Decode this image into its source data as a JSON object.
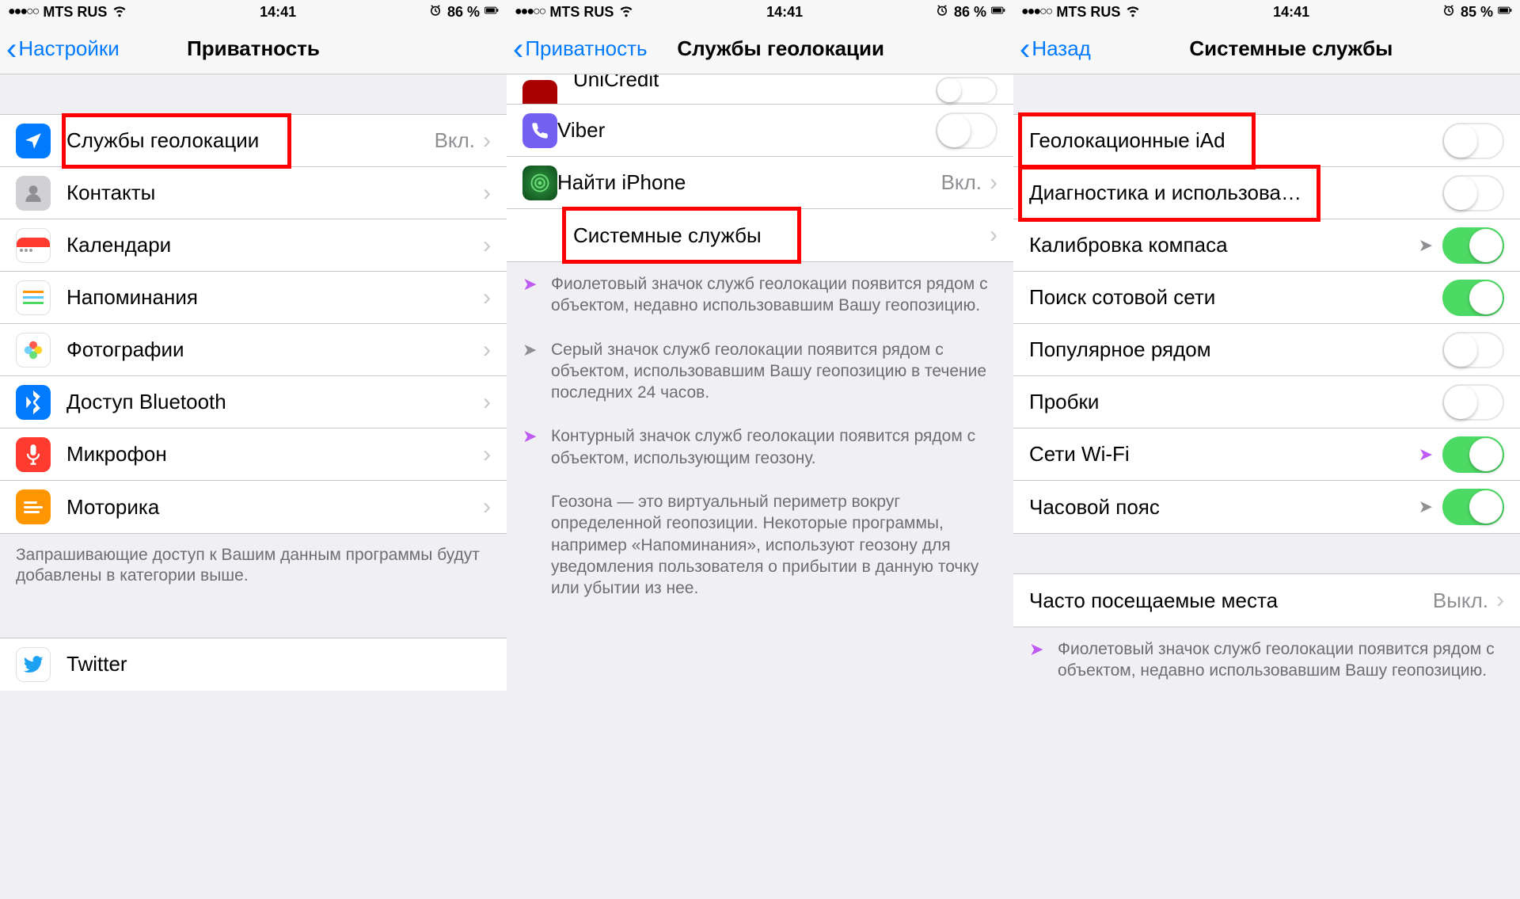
{
  "status": {
    "carrier": "MTS RUS",
    "time": "14:41",
    "battery1": "86 %",
    "battery2": "86 %",
    "battery3": "85 %",
    "signal_dots": "●●●○○"
  },
  "screen1": {
    "back": "Настройки",
    "title": "Приватность",
    "rows": [
      {
        "label": "Службы геолокации",
        "value": "Вкл.",
        "icon_bg": "#007aff",
        "glyph": "➤",
        "name": "location-services"
      },
      {
        "label": "Контакты",
        "icon_bg": "#d9d9de",
        "glyph": "👤",
        "name": "contacts"
      },
      {
        "label": "Календари",
        "icon_bg": "#ffffff",
        "glyph": "📅",
        "name": "calendars"
      },
      {
        "label": "Напоминания",
        "icon_bg": "#ffffff",
        "glyph": "☰",
        "name": "reminders"
      },
      {
        "label": "Фотографии",
        "icon_bg": "#ffffff",
        "glyph": "✿",
        "name": "photos"
      },
      {
        "label": "Доступ Bluetooth",
        "icon_bg": "#007aff",
        "glyph": "B",
        "name": "bluetooth-access"
      },
      {
        "label": "Микрофон",
        "icon_bg": "#ff3b30",
        "glyph": "🎤",
        "name": "microphone"
      },
      {
        "label": "Моторика",
        "icon_bg": "#ff9500",
        "glyph": "≡",
        "name": "motorics"
      }
    ],
    "footer": "Запрашивающие доступ к Вашим данным программы будут добавлены в категории выше.",
    "bottom_row": {
      "label": "Twitter",
      "icon_bg": "#ffffff",
      "glyph": "🐦",
      "name": "twitter"
    }
  },
  "screen2": {
    "back": "Приватность",
    "title": "Службы геолокации",
    "partial_top": "UniCredit",
    "rows": [
      {
        "label": "Viber",
        "icon_bg": "#7360f2",
        "glyph": "V",
        "toggle": "off",
        "name": "viber"
      },
      {
        "label": "Найти iPhone",
        "icon_bg": "#1a6b2d",
        "glyph": "◉",
        "value": "Вкл.",
        "chevron": true,
        "name": "find-iphone"
      },
      {
        "label": "Системные службы",
        "chevron": true,
        "no_icon": true,
        "name": "system-services"
      }
    ],
    "notes": [
      {
        "arrow": "purple",
        "text": "Фиолетовый значок служб геолокации появится рядом с объектом, недавно использовавшим Вашу геопозицию."
      },
      {
        "arrow": "gray",
        "text": "Серый значок служб геолокации появится рядом с объектом, использовавшим Вашу геопозицию в течение последних 24 часов."
      },
      {
        "arrow": "outline",
        "text": "Контурный значок служб геолокации появится рядом с объектом, использующим геозону."
      }
    ],
    "geofence_text": "Геозона — это виртуальный периметр вокруг определенной геопозиции. Некоторые программы, например «Напоминания», используют геозону для уведомления пользователя о прибытии в данную точку или убытии из нее."
  },
  "screen3": {
    "back": "Назад",
    "title": "Системные службы",
    "rows": [
      {
        "label": "Геолокационные iAd",
        "toggle": "off",
        "name": "location-iad"
      },
      {
        "label": "Диагностика и использова…",
        "toggle": "off",
        "name": "diagnostics-usage"
      },
      {
        "label": "Калибровка компаса",
        "toggle": "on",
        "indicator": "gray",
        "name": "compass-calibration"
      },
      {
        "label": "Поиск сотовой сети",
        "toggle": "on",
        "name": "cell-network-search"
      },
      {
        "label": "Популярное рядом",
        "toggle": "off",
        "name": "popular-nearby"
      },
      {
        "label": "Пробки",
        "toggle": "off",
        "name": "traffic"
      },
      {
        "label": "Сети Wi-Fi",
        "toggle": "on",
        "indicator": "purple",
        "name": "wifi-networks"
      },
      {
        "label": "Часовой пояс",
        "toggle": "on",
        "indicator": "gray",
        "name": "timezone"
      }
    ],
    "freq_row": {
      "label": "Часто посещаемые места",
      "value": "Выкл.",
      "name": "frequent-locations"
    },
    "note": {
      "arrow": "purple",
      "text": "Фиолетовый значок служб геолокации появится рядом с объектом, недавно использовавшим Вашу геопозицию."
    }
  }
}
